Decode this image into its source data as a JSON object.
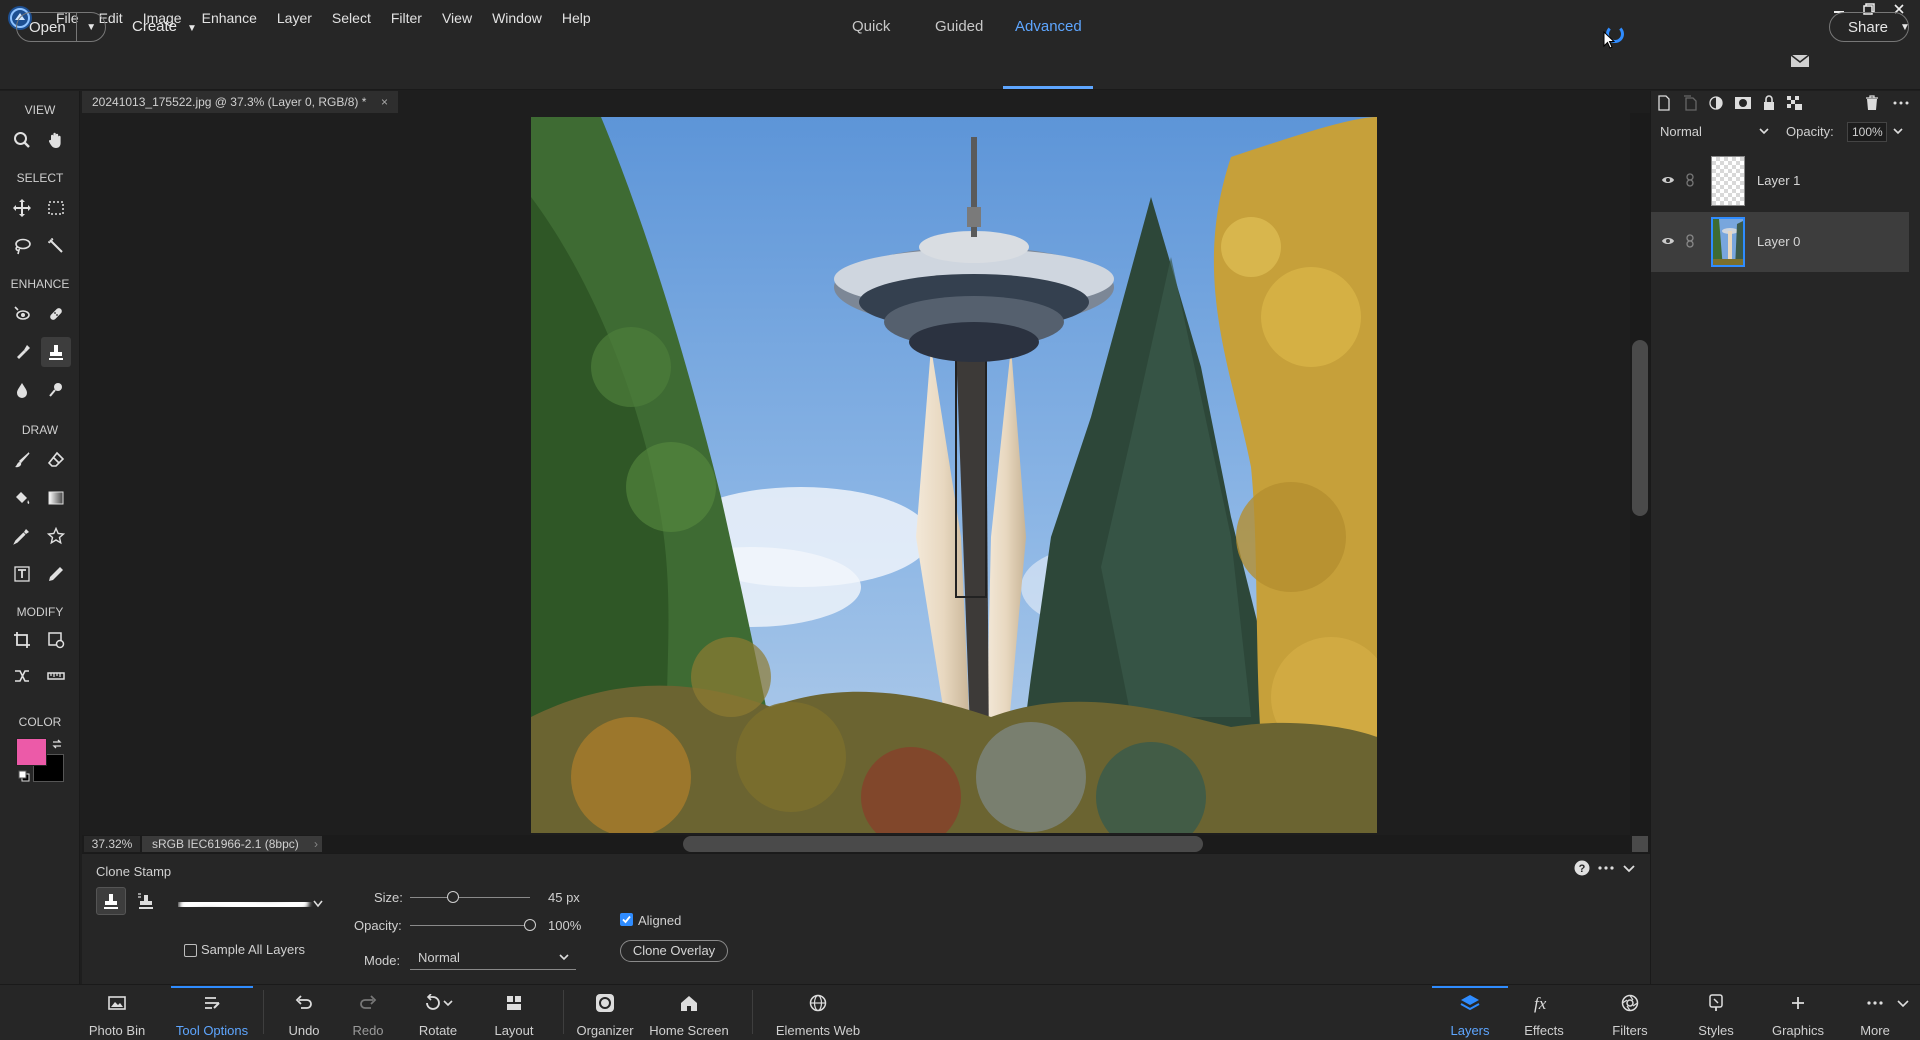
{
  "menu": [
    "File",
    "Edit",
    "Image",
    "Enhance",
    "Layer",
    "Select",
    "Filter",
    "View",
    "Window",
    "Help"
  ],
  "header": {
    "open_label": "Open",
    "create_label": "Create",
    "modes": [
      "Quick",
      "Guided",
      "Advanced"
    ],
    "active_mode": "Advanced",
    "share_label": "Share"
  },
  "toolbox": {
    "sections": [
      "VIEW",
      "SELECT",
      "ENHANCE",
      "DRAW",
      "MODIFY",
      "COLOR"
    ],
    "foreground_color": "#ec5aa8",
    "background_color": "#000000"
  },
  "document": {
    "tab_title": "20241013_175522.jpg @ 37.3% (Layer 0, RGB/8) *",
    "close_glyph": "×",
    "zoom": "37.32%",
    "color_profile": "sRGB IEC61966-2.1 (8bpc)"
  },
  "tool_options": {
    "tool_name": "Clone Stamp",
    "size_label": "Size:",
    "size_value": "45 px",
    "size_fraction": 0.36,
    "opacity_label": "Opacity:",
    "opacity_value": "100%",
    "opacity_fraction": 1.0,
    "mode_label": "Mode:",
    "mode_value": "Normal",
    "aligned_label": "Aligned",
    "aligned_checked": true,
    "sample_all_layers_label": "Sample All Layers",
    "sample_all_layers_checked": false,
    "clone_overlay_label": "Clone Overlay"
  },
  "layers": {
    "blend_mode": "Normal",
    "opacity_label": "Opacity:",
    "opacity_value": "100%",
    "items": [
      {
        "name": "Layer 1",
        "selected": false
      },
      {
        "name": "Layer 0",
        "selected": true
      }
    ]
  },
  "taskbar": {
    "left": [
      "Photo Bin",
      "Tool Options",
      "Undo",
      "Redo",
      "Rotate",
      "Layout",
      "Organizer",
      "Home Screen",
      "Elements Web"
    ],
    "right": [
      "Layers",
      "Effects",
      "Filters",
      "Styles",
      "Graphics",
      "More"
    ],
    "active_left": "Tool Options",
    "active_right": "Layers"
  },
  "colors": {
    "accent": "#2f8cff",
    "accent_text": "#5ea6ff",
    "panel": "#262626"
  }
}
